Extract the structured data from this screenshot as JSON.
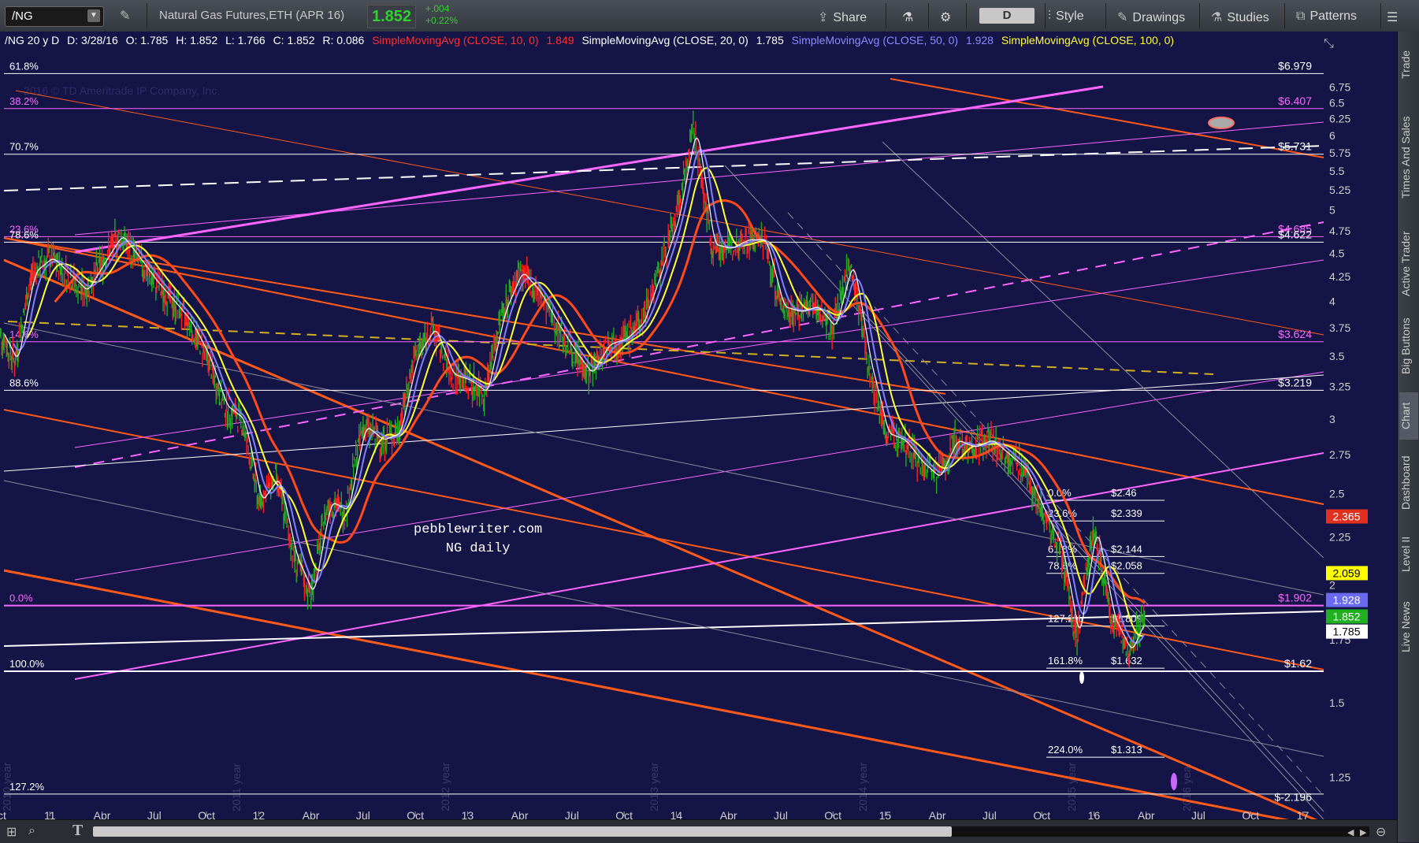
{
  "toolbar": {
    "symbol": "/NG",
    "description": "Natural Gas Futures,ETH (APR 16)",
    "last_price": "1.852",
    "change_abs": "+.004",
    "change_pct": "+0.22%",
    "share_label": "Share",
    "period_label": "D",
    "style_label": "Style",
    "drawings_label": "Drawings",
    "studies_label": "Studies",
    "patterns_label": "Patterns"
  },
  "header": {
    "desc": "/NG 20 y D",
    "date": "D: 3/28/16",
    "open": "O: 1.785",
    "high": "H: 1.852",
    "low": "L: 1.766",
    "close": "C: 1.852",
    "range": "R: 0.086",
    "sma10_label": "SimpleMovingAvg (CLOSE, 10, 0)",
    "sma10_value": "1.849",
    "sma20_label": "SimpleMovingAvg (CLOSE, 20, 0)",
    "sma20_value": "1.785",
    "sma50_label": "SimpleMovingAvg (CLOSE, 50, 0)",
    "sma50_value": "1.928",
    "sma100_label": "SimpleMovingAvg (CLOSE, 100, 0)"
  },
  "watermark": {
    "copyright": "2016 © TD Ameritrade IP Company, Inc."
  },
  "right_tabs": [
    "Trade",
    "Times And Sales",
    "Active Trader",
    "Big Buttons",
    "Chart",
    "Dashboard",
    "Level II",
    "Live News"
  ],
  "active_tab": "Chart",
  "colors": {
    "bg": "#141446",
    "sma10": "#ffffff",
    "sma20": "#ffff33",
    "sma50": "#8080ff",
    "sma100": "#ff4a1a",
    "fib_magenta": "#ff66ff",
    "channel_orange": "#ff5a1a",
    "price_up": "#ff2020",
    "price_down": "#22aa22"
  },
  "chart_data": {
    "type": "line",
    "title": "pebblewriter.com NG daily",
    "title_line1": "pebblewriter.com",
    "title_line2": "NG daily",
    "y_scale": "log",
    "ylim": [
      1.15,
      7.3
    ],
    "y_ticks": [
      "6.75",
      "6.5",
      "6.25",
      "6",
      "5.75",
      "5.5",
      "5.25",
      "5",
      "4.75",
      "4.5",
      "4.25",
      "4",
      "3.75",
      "3.5",
      "3.25",
      "3",
      "2.75",
      "2.5",
      "2.25",
      "2",
      "1.75",
      "1.5",
      "1.25"
    ],
    "x_ticks": [
      "Oct",
      "11",
      "Apr",
      "Jul",
      "Oct",
      "12",
      "Apr",
      "Jul",
      "Oct",
      "13",
      "Apr",
      "Jul",
      "Oct",
      "14",
      "Apr",
      "Jul",
      "Oct",
      "15",
      "Apr",
      "Jul",
      "Oct",
      "16",
      "Apr",
      "Jul",
      "Oct",
      "17"
    ],
    "year_labels": [
      "2010 year",
      "2011 year",
      "2012 year",
      "2013 year",
      "2014 year",
      "2015 year",
      "2016 year"
    ],
    "series": [
      {
        "name": "SimpleMovingAvg (CLOSE, 10, 0)",
        "last": 1.849
      },
      {
        "name": "SimpleMovingAvg (CLOSE, 20, 0)",
        "last": 1.785
      },
      {
        "name": "SimpleMovingAvg (CLOSE, 50, 0)",
        "last": 1.928
      },
      {
        "name": "SimpleMovingAvg (CLOSE, 100, 0)"
      }
    ],
    "price_path": [
      [
        "2010-10",
        3.75
      ],
      [
        "2010-11",
        3.45
      ],
      [
        "2010-12",
        4.3
      ],
      [
        "2011-01",
        4.45
      ],
      [
        "2011-03",
        4.1
      ],
      [
        "2011-05",
        4.7
      ],
      [
        "2011-06",
        4.45
      ],
      [
        "2011-07",
        4.2
      ],
      [
        "2011-08",
        4.0
      ],
      [
        "2011-09",
        3.8
      ],
      [
        "2011-10",
        3.5
      ],
      [
        "2011-11",
        3.1
      ],
      [
        "2011-12",
        3.0
      ],
      [
        "2012-01",
        2.45
      ],
      [
        "2012-02",
        2.6
      ],
      [
        "2012-03",
        2.15
      ],
      [
        "2012-04",
        1.95
      ],
      [
        "2012-05",
        2.45
      ],
      [
        "2012-06",
        2.4
      ],
      [
        "2012-07",
        2.95
      ],
      [
        "2012-08",
        2.85
      ],
      [
        "2012-09",
        2.9
      ],
      [
        "2012-10",
        3.5
      ],
      [
        "2012-11",
        3.75
      ],
      [
        "2012-12",
        3.35
      ],
      [
        "2013-01",
        3.3
      ],
      [
        "2013-02",
        3.2
      ],
      [
        "2013-03",
        3.9
      ],
      [
        "2013-04",
        4.3
      ],
      [
        "2013-05",
        4.1
      ],
      [
        "2013-06",
        3.8
      ],
      [
        "2013-07",
        3.55
      ],
      [
        "2013-08",
        3.35
      ],
      [
        "2013-09",
        3.6
      ],
      [
        "2013-10",
        3.65
      ],
      [
        "2013-11",
        3.8
      ],
      [
        "2013-12",
        4.3
      ],
      [
        "2014-01",
        4.9
      ],
      [
        "2014-02",
        6.1
      ],
      [
        "2014-03",
        4.6
      ],
      [
        "2014-04",
        4.55
      ],
      [
        "2014-05",
        4.65
      ],
      [
        "2014-06",
        4.65
      ],
      [
        "2014-07",
        3.95
      ],
      [
        "2014-08",
        3.9
      ],
      [
        "2014-09",
        3.95
      ],
      [
        "2014-10",
        3.75
      ],
      [
        "2014-11",
        4.4
      ],
      [
        "2014-12",
        3.45
      ],
      [
        "2015-01",
        2.9
      ],
      [
        "2015-02",
        2.85
      ],
      [
        "2015-03",
        2.7
      ],
      [
        "2015-04",
        2.6
      ],
      [
        "2015-05",
        2.85
      ],
      [
        "2015-06",
        2.8
      ],
      [
        "2015-07",
        2.85
      ],
      [
        "2015-08",
        2.75
      ],
      [
        "2015-09",
        2.65
      ],
      [
        "2015-10",
        2.4
      ],
      [
        "2015-11",
        2.2
      ],
      [
        "2015-12",
        1.75
      ],
      [
        "2016-01",
        2.3
      ],
      [
        "2016-02",
        1.85
      ],
      [
        "2016-03",
        1.7
      ],
      [
        "2016-03-28",
        1.852
      ]
    ],
    "horizontal_levels": [
      {
        "value": 6.979,
        "label": "$6.979",
        "left_label": "61.8%",
        "color": "white"
      },
      {
        "value": 6.407,
        "label": "$6.407",
        "left_label": "38.2%",
        "color": "magenta"
      },
      {
        "value": 5.731,
        "label": "$5.731",
        "left_label": "70.7%",
        "color": "white"
      },
      {
        "value": 4.685,
        "label": "$4.685",
        "left_label": "23.6%",
        "color": "magenta"
      },
      {
        "value": 4.622,
        "label": "$4.622",
        "left_label": "78.6%",
        "color": "white"
      },
      {
        "value": 3.624,
        "label": "$3.624",
        "left_label": "14.6%",
        "color": "magenta"
      },
      {
        "value": 3.219,
        "label": "$3.219",
        "left_label": "88.6%",
        "color": "white"
      },
      {
        "value": 1.902,
        "label": "$1.902",
        "left_label": "0.0%",
        "color": "magenta"
      },
      {
        "value": 1.62,
        "label": "$1.62",
        "left_label": "100.0%",
        "color": "white"
      },
      {
        "value": 1.2,
        "label": "",
        "left_label": "127.2%",
        "color": "white"
      }
    ],
    "fib_levels": [
      {
        "pct": "0.0%",
        "price": "$2.46",
        "value": 2.46
      },
      {
        "pct": "23.6%",
        "price": "$2.339",
        "value": 2.339
      },
      {
        "pct": "61.8%",
        "price": "$2.144",
        "value": 2.144
      },
      {
        "pct": "78.6%",
        "price": "$2.058",
        "value": 2.058
      },
      {
        "pct": "127.2%",
        "price": "$1.809",
        "value": 1.809
      },
      {
        "pct": "161.8%",
        "price": "$1.632",
        "value": 1.632
      },
      {
        "pct": "224.0%",
        "price": "$1.313",
        "value": 1.313
      }
    ],
    "extra_label": "$-2.196",
    "price_badges": [
      {
        "text": "2.365",
        "value": 2.365,
        "bg": "#e03020",
        "fg": "#ffffff"
      },
      {
        "text": "2.059",
        "value": 2.059,
        "bg": "#ffff00",
        "fg": "#000000"
      },
      {
        "text": "1.928",
        "value": 1.928,
        "bg": "#6a6af0",
        "fg": "#ffffff"
      },
      {
        "text": "1.852",
        "value": 1.852,
        "bg": "#20b020",
        "fg": "#ffffff"
      },
      {
        "text": "1.785",
        "value": 1.785,
        "bg": "#ffffff",
        "fg": "#000000"
      }
    ]
  }
}
